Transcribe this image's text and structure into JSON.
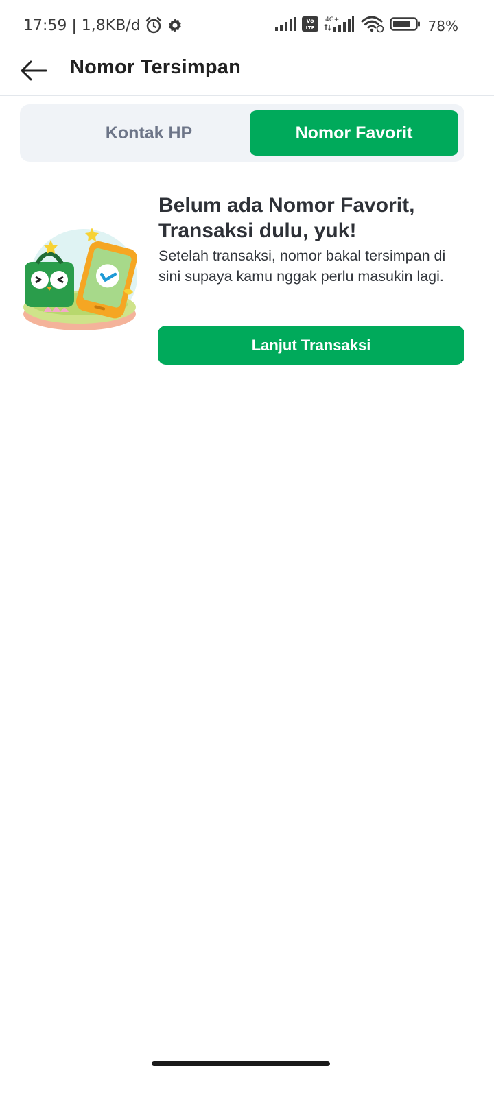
{
  "status_bar": {
    "time_and_data": "17:59 | 1,8KB/d",
    "alarm_icon": "alarm-icon",
    "settings_icon": "gear-icon",
    "network_label": "4G+",
    "volte_label": "Vo LTE",
    "battery_percent": "78%",
    "battery_level": 0.78
  },
  "header": {
    "back_icon": "arrow-left-icon",
    "title": "Nomor Tersimpan"
  },
  "tabs": [
    {
      "label": "Kontak HP",
      "active": false
    },
    {
      "label": "Nomor Favorit",
      "active": true
    }
  ],
  "empty_state": {
    "illustration": "owl-bag-phone-check-illustration",
    "title": "Belum ada Nomor Favorit, Transaksi dulu, yuk!",
    "description": "Setelah transaksi, nomor bakal tersimpan di sini supaya kamu nggak perlu masukin lagi.",
    "button_label": "Lanjut Transaksi"
  },
  "colors": {
    "primary_green": "#00aa5b",
    "tab_background": "#f0f3f7",
    "inactive_tab_text": "#6d7588"
  }
}
